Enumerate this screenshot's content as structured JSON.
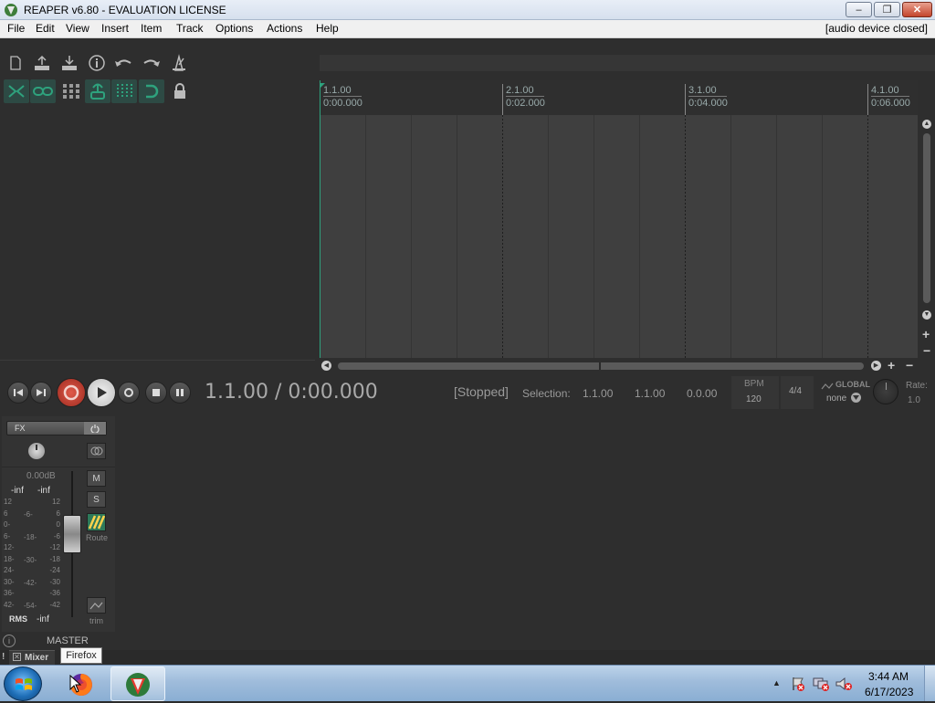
{
  "window": {
    "title": "REAPER v6.80 - EVALUATION LICENSE",
    "min": "–",
    "max": "❐",
    "close": "✕"
  },
  "menu": {
    "items": [
      "File",
      "Edit",
      "View",
      "Insert",
      "Item",
      "Track",
      "Options",
      "Actions",
      "Help"
    ],
    "audio_status": "[audio device closed]"
  },
  "ruler": {
    "marks": [
      {
        "bar": "1.1.00",
        "time": "0:00.000"
      },
      {
        "bar": "2.1.00",
        "time": "0:02.000"
      },
      {
        "bar": "3.1.00",
        "time": "0:04.000"
      },
      {
        "bar": "4.1.00",
        "time": "0:06.000"
      }
    ]
  },
  "transport": {
    "position": "1.1.00 / 0:00.000",
    "state": "[Stopped]",
    "selection_label": "Selection:",
    "sel_start": "1.1.00",
    "sel_end": "1.1.00",
    "sel_len": "0.0.00",
    "bpm_label": "BPM",
    "bpm": "120",
    "timesig": "4/4",
    "global_label": "GLOBAL",
    "global_value": "none",
    "rate_label": "Rate:",
    "rate": "1.0"
  },
  "mixer": {
    "fx_label": "FX",
    "volume_db": "0.00dB",
    "peak_left": "-inf",
    "peak_right": "-inf",
    "mute": "M",
    "solo": "S",
    "route": "Route",
    "trim": "trim",
    "rms_label": "RMS",
    "rms_value": "-inf",
    "scale_outer": [
      "12",
      "6",
      "0-",
      "6-",
      "12-",
      "18-",
      "24-",
      "30-",
      "36-",
      "42-"
    ],
    "scale_inner": [
      "-6-",
      "-18-",
      "-30-",
      "-42-",
      "-54-"
    ],
    "scale_right": [
      "12",
      "6",
      "0",
      "-6",
      "-12",
      "-18",
      "-24",
      "-30",
      "-36",
      "-42"
    ],
    "track_name": "MASTER",
    "mixer_tab": "Mixer"
  },
  "tooltip": "Firefox",
  "taskbar": {
    "time": "3:44 AM",
    "date": "6/17/2023"
  },
  "colors": {
    "accent_green": "#2ea27d",
    "record_red": "#c0392b",
    "bg_dark": "#2e2e2e"
  }
}
